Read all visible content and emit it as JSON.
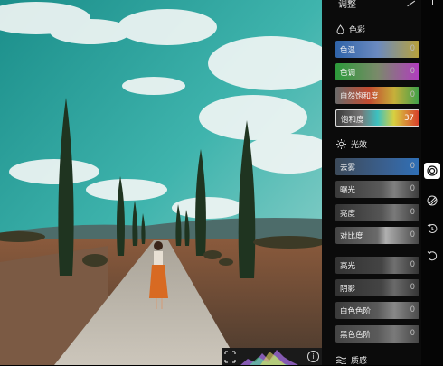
{
  "panel": {
    "title": "调整",
    "color_section": {
      "title": "色彩",
      "sliders": [
        {
          "label": "色温",
          "value": "0"
        },
        {
          "label": "色调",
          "value": "0"
        },
        {
          "label": "自然饱和度",
          "value": "0"
        },
        {
          "label": "饱和度",
          "value": "37"
        }
      ]
    },
    "light_section": {
      "title": "光效",
      "sliders": [
        {
          "label": "去雾",
          "value": "0"
        },
        {
          "label": "曝光",
          "value": "0"
        },
        {
          "label": "亮度",
          "value": "0"
        },
        {
          "label": "对比度",
          "value": "0"
        },
        {
          "label": "高光",
          "value": "0"
        },
        {
          "label": "阴影",
          "value": "0"
        },
        {
          "label": "白色色阶",
          "value": "0"
        },
        {
          "label": "黑色色阶",
          "value": "0"
        }
      ]
    },
    "texture_section": {
      "title": "质感"
    }
  },
  "rail_icons": [
    "adjust-icon",
    "filter-icon",
    "history-icon",
    "undo-icon"
  ],
  "histogram": {
    "info_glyph": "i"
  }
}
